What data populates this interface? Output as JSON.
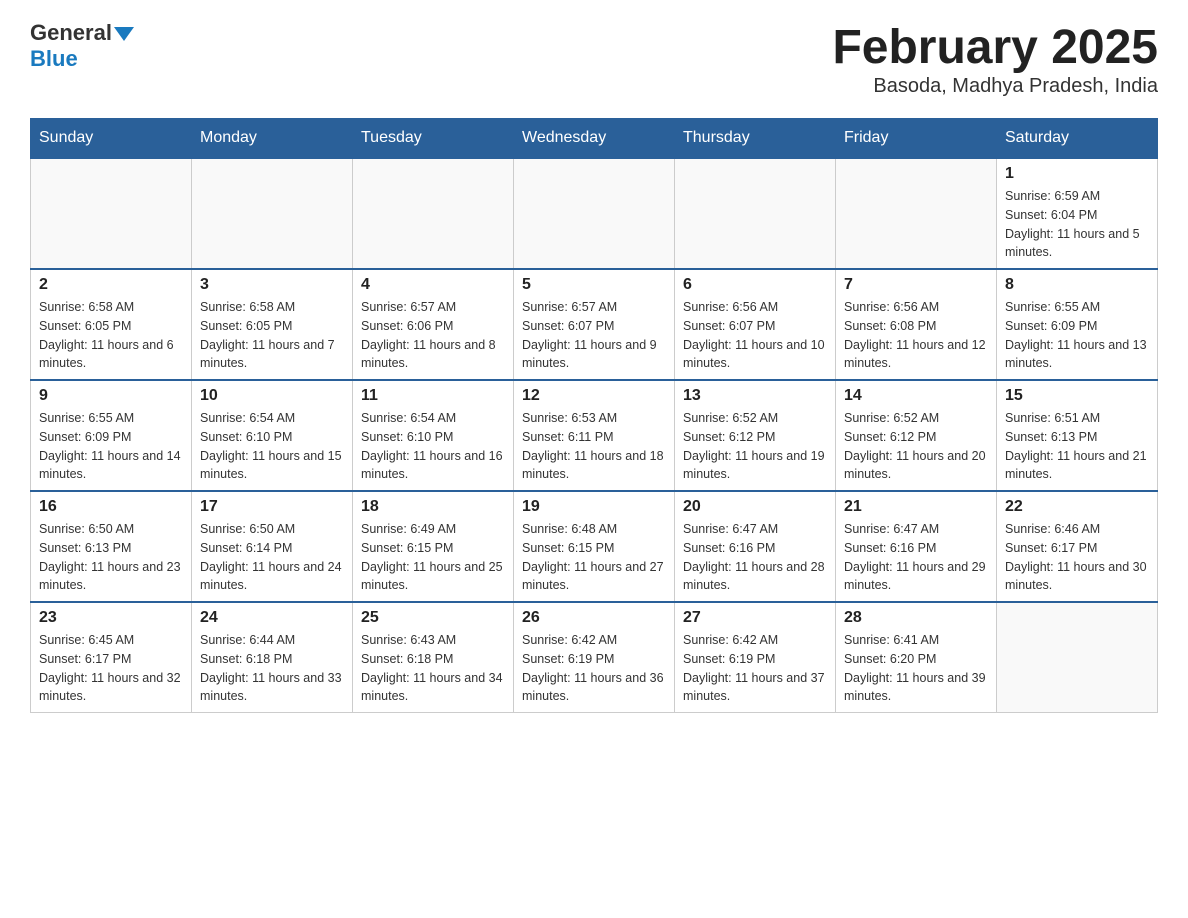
{
  "header": {
    "logo_general": "General",
    "logo_blue": "Blue",
    "title": "February 2025",
    "subtitle": "Basoda, Madhya Pradesh, India"
  },
  "days_of_week": [
    "Sunday",
    "Monday",
    "Tuesday",
    "Wednesday",
    "Thursday",
    "Friday",
    "Saturday"
  ],
  "weeks": [
    [
      {
        "day": "",
        "info": ""
      },
      {
        "day": "",
        "info": ""
      },
      {
        "day": "",
        "info": ""
      },
      {
        "day": "",
        "info": ""
      },
      {
        "day": "",
        "info": ""
      },
      {
        "day": "",
        "info": ""
      },
      {
        "day": "1",
        "info": "Sunrise: 6:59 AM\nSunset: 6:04 PM\nDaylight: 11 hours and 5 minutes."
      }
    ],
    [
      {
        "day": "2",
        "info": "Sunrise: 6:58 AM\nSunset: 6:05 PM\nDaylight: 11 hours and 6 minutes."
      },
      {
        "day": "3",
        "info": "Sunrise: 6:58 AM\nSunset: 6:05 PM\nDaylight: 11 hours and 7 minutes."
      },
      {
        "day": "4",
        "info": "Sunrise: 6:57 AM\nSunset: 6:06 PM\nDaylight: 11 hours and 8 minutes."
      },
      {
        "day": "5",
        "info": "Sunrise: 6:57 AM\nSunset: 6:07 PM\nDaylight: 11 hours and 9 minutes."
      },
      {
        "day": "6",
        "info": "Sunrise: 6:56 AM\nSunset: 6:07 PM\nDaylight: 11 hours and 10 minutes."
      },
      {
        "day": "7",
        "info": "Sunrise: 6:56 AM\nSunset: 6:08 PM\nDaylight: 11 hours and 12 minutes."
      },
      {
        "day": "8",
        "info": "Sunrise: 6:55 AM\nSunset: 6:09 PM\nDaylight: 11 hours and 13 minutes."
      }
    ],
    [
      {
        "day": "9",
        "info": "Sunrise: 6:55 AM\nSunset: 6:09 PM\nDaylight: 11 hours and 14 minutes."
      },
      {
        "day": "10",
        "info": "Sunrise: 6:54 AM\nSunset: 6:10 PM\nDaylight: 11 hours and 15 minutes."
      },
      {
        "day": "11",
        "info": "Sunrise: 6:54 AM\nSunset: 6:10 PM\nDaylight: 11 hours and 16 minutes."
      },
      {
        "day": "12",
        "info": "Sunrise: 6:53 AM\nSunset: 6:11 PM\nDaylight: 11 hours and 18 minutes."
      },
      {
        "day": "13",
        "info": "Sunrise: 6:52 AM\nSunset: 6:12 PM\nDaylight: 11 hours and 19 minutes."
      },
      {
        "day": "14",
        "info": "Sunrise: 6:52 AM\nSunset: 6:12 PM\nDaylight: 11 hours and 20 minutes."
      },
      {
        "day": "15",
        "info": "Sunrise: 6:51 AM\nSunset: 6:13 PM\nDaylight: 11 hours and 21 minutes."
      }
    ],
    [
      {
        "day": "16",
        "info": "Sunrise: 6:50 AM\nSunset: 6:13 PM\nDaylight: 11 hours and 23 minutes."
      },
      {
        "day": "17",
        "info": "Sunrise: 6:50 AM\nSunset: 6:14 PM\nDaylight: 11 hours and 24 minutes."
      },
      {
        "day": "18",
        "info": "Sunrise: 6:49 AM\nSunset: 6:15 PM\nDaylight: 11 hours and 25 minutes."
      },
      {
        "day": "19",
        "info": "Sunrise: 6:48 AM\nSunset: 6:15 PM\nDaylight: 11 hours and 27 minutes."
      },
      {
        "day": "20",
        "info": "Sunrise: 6:47 AM\nSunset: 6:16 PM\nDaylight: 11 hours and 28 minutes."
      },
      {
        "day": "21",
        "info": "Sunrise: 6:47 AM\nSunset: 6:16 PM\nDaylight: 11 hours and 29 minutes."
      },
      {
        "day": "22",
        "info": "Sunrise: 6:46 AM\nSunset: 6:17 PM\nDaylight: 11 hours and 30 minutes."
      }
    ],
    [
      {
        "day": "23",
        "info": "Sunrise: 6:45 AM\nSunset: 6:17 PM\nDaylight: 11 hours and 32 minutes."
      },
      {
        "day": "24",
        "info": "Sunrise: 6:44 AM\nSunset: 6:18 PM\nDaylight: 11 hours and 33 minutes."
      },
      {
        "day": "25",
        "info": "Sunrise: 6:43 AM\nSunset: 6:18 PM\nDaylight: 11 hours and 34 minutes."
      },
      {
        "day": "26",
        "info": "Sunrise: 6:42 AM\nSunset: 6:19 PM\nDaylight: 11 hours and 36 minutes."
      },
      {
        "day": "27",
        "info": "Sunrise: 6:42 AM\nSunset: 6:19 PM\nDaylight: 11 hours and 37 minutes."
      },
      {
        "day": "28",
        "info": "Sunrise: 6:41 AM\nSunset: 6:20 PM\nDaylight: 11 hours and 39 minutes."
      },
      {
        "day": "",
        "info": ""
      }
    ]
  ]
}
